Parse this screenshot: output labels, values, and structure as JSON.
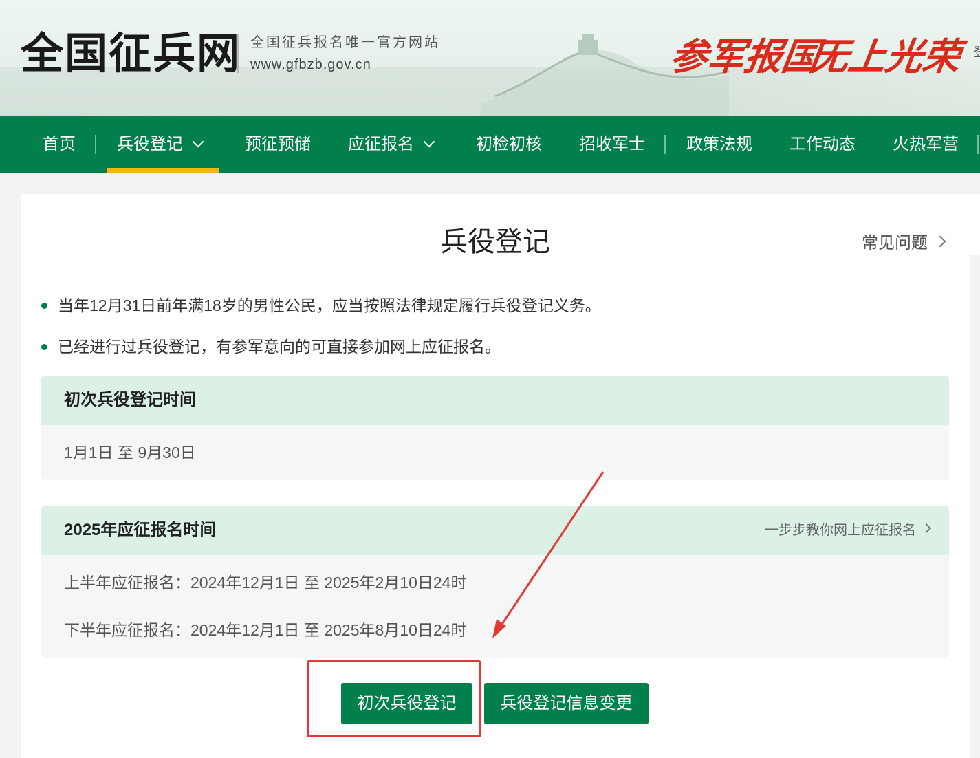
{
  "header": {
    "site_title": "全国征兵网",
    "site_subtitle": "全国征兵报名唯一官方网站",
    "site_url": "www.gfbzb.gov.cn",
    "slogan_1": "参军报国",
    "slogan_2": "无上光荣",
    "edge_text": "登"
  },
  "nav": {
    "items": [
      {
        "label": "首页"
      },
      {
        "label": "兵役登记",
        "active": true,
        "dropdown": true
      },
      {
        "label": "预征预储"
      },
      {
        "label": "应征报名",
        "dropdown": true
      },
      {
        "label": "初检初核"
      },
      {
        "label": "招收军士"
      },
      {
        "label": "政策法规"
      },
      {
        "label": "工作动态"
      },
      {
        "label": "火热军营"
      }
    ]
  },
  "main": {
    "title": "兵役登记",
    "faq_link": "常见问题",
    "bullets": [
      "当年12月31日前年满18岁的男性公民，应当按照法律规定履行兵役登记义务。",
      "已经进行过兵役登记，有参军意向的可直接参加网上应征报名。"
    ],
    "first_registration": {
      "heading": "初次兵役登记时间",
      "period": "1月1日 至 9月30日"
    },
    "enlistment": {
      "heading": "2025年应征报名时间",
      "guide_link": "一步步教你网上应征报名",
      "first_half": "上半年应征报名：2024年12月1日 至 2025年2月10日24时",
      "second_half": "下半年应征报名：2024年12月1日 至 2025年8月10日24时"
    },
    "buttons": {
      "first_register": "初次兵役登记",
      "change_info": "兵役登记信息变更"
    }
  },
  "colors": {
    "brand_green": "#01804b",
    "active_underline": "#f3b41b",
    "slogan_red": "#d92a1c",
    "annotation_red": "#e53935",
    "box_header_bg": "#dcf1e5"
  }
}
